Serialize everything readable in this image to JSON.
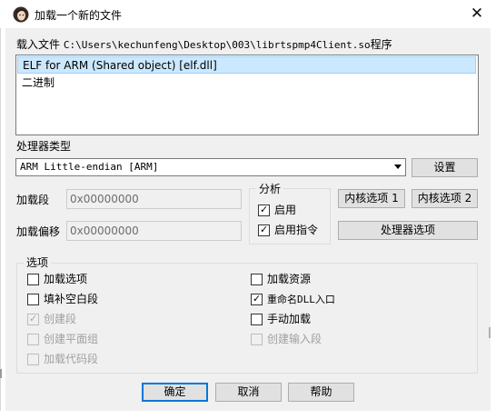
{
  "window": {
    "title": "加载一个新的文件",
    "close_glyph": "✕"
  },
  "load_file": {
    "label_prefix": "载入文件",
    "path": "C:\\Users\\kechunfeng\\Desktop\\003\\librtspmp4Client.so",
    "label_suffix": "程序"
  },
  "format_list": {
    "items": [
      {
        "label": "ELF for ARM (Shared object) [elf.dll]",
        "selected": true
      },
      {
        "label": "二进制",
        "selected": false
      }
    ]
  },
  "processor": {
    "label": "处理器类型",
    "selected": "ARM Little-endian [ARM]",
    "settings_button": "设置"
  },
  "load_segment": {
    "label": "加载段",
    "value": "0x00000000"
  },
  "load_offset": {
    "label": "加载偏移",
    "value": "0x00000000"
  },
  "analysis": {
    "title": "分析",
    "enable": {
      "label": "启用",
      "checked": true
    },
    "enable_instructions": {
      "label": "启用指令",
      "checked": true
    }
  },
  "buttons": {
    "kernel1": "内核选项 1",
    "kernel2": "内核选项 2",
    "processor_options": "处理器选项",
    "ok": "确定",
    "cancel": "取消",
    "help": "帮助"
  },
  "options": {
    "title": "选项",
    "load_options": {
      "label": "加载选项",
      "checked": false,
      "enabled": true
    },
    "fill_gaps": {
      "label": "填补空白段",
      "checked": false,
      "enabled": true
    },
    "create_segments": {
      "label": "创建段",
      "checked": true,
      "enabled": false
    },
    "create_flat_group": {
      "label": "创建平面组",
      "checked": false,
      "enabled": false
    },
    "load_code_segments": {
      "label": "加载代码段",
      "checked": false,
      "enabled": false
    },
    "load_resources": {
      "label": "加载资源",
      "checked": false,
      "enabled": true
    },
    "rename_dll_entries": {
      "label": "重命名DLL入口",
      "checked": true,
      "enabled": true
    },
    "manual_load": {
      "label": "手动加载",
      "checked": false,
      "enabled": true
    },
    "create_imports_segment": {
      "label": "创建输入段",
      "checked": false,
      "enabled": false
    }
  },
  "icons": {
    "app": "app-avatar-icon",
    "close": "close-icon",
    "dropdown": "chevron-down-icon",
    "check": "checkmark-icon"
  },
  "colors": {
    "selection_bg": "#cce8ff",
    "default_button_border": "#0078d7",
    "dialog_bg": "#f0f0f0"
  }
}
